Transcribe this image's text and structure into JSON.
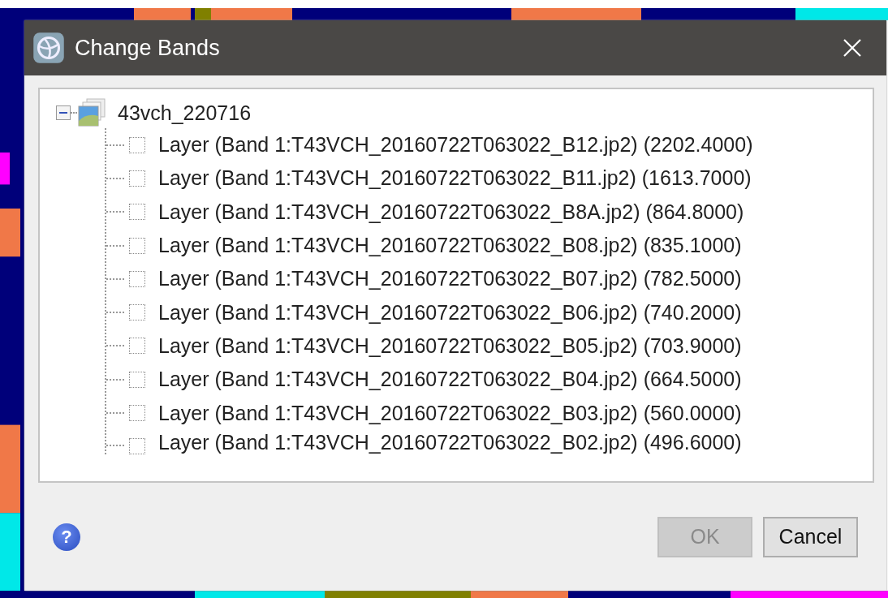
{
  "window": {
    "title": "Change Bands"
  },
  "tree": {
    "label": "43vch_220716",
    "expanded": true,
    "children": [
      {
        "label": "Layer (Band 1:T43VCH_20160722T063022_B12.jp2) (2202.4000)",
        "checked": false
      },
      {
        "label": "Layer (Band 1:T43VCH_20160722T063022_B11.jp2) (1613.7000)",
        "checked": false
      },
      {
        "label": "Layer (Band 1:T43VCH_20160722T063022_B8A.jp2) (864.8000)",
        "checked": false
      },
      {
        "label": "Layer (Band 1:T43VCH_20160722T063022_B08.jp2) (835.1000)",
        "checked": false
      },
      {
        "label": "Layer (Band 1:T43VCH_20160722T063022_B07.jp2) (782.5000)",
        "checked": false
      },
      {
        "label": "Layer (Band 1:T43VCH_20160722T063022_B06.jp2) (740.2000)",
        "checked": false
      },
      {
        "label": "Layer (Band 1:T43VCH_20160722T063022_B05.jp2) (703.9000)",
        "checked": false
      },
      {
        "label": "Layer (Band 1:T43VCH_20160722T063022_B04.jp2) (664.5000)",
        "checked": false
      },
      {
        "label": "Layer (Band 1:T43VCH_20160722T063022_B03.jp2) (560.0000)",
        "checked": false
      },
      {
        "label": "Layer (Band 1:T43VCH_20160722T063022_B02.jp2) (496.6000)",
        "checked": false
      }
    ]
  },
  "help": "?",
  "buttons": [
    {
      "label": "OK",
      "disabled": true
    },
    {
      "label": "Cancel",
      "disabled": false
    }
  ]
}
